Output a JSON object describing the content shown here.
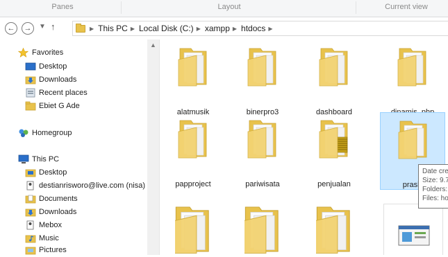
{
  "ribbon": {
    "groups": [
      "Panes",
      "Layout",
      "Current view"
    ]
  },
  "address": {
    "crumbs": [
      "This PC",
      "Local Disk (C:)",
      "xampp",
      "htdocs"
    ]
  },
  "nav": {
    "favorites": "Favorites",
    "favorites_items": [
      "Desktop",
      "Downloads",
      "Recent places",
      "Ebiet G Ade"
    ],
    "homegroup": "Homegroup",
    "thispc": "This PC",
    "thispc_items": [
      "Desktop",
      "destianrisworo@live.com (nisa)",
      "Documents",
      "Downloads",
      "Mebox",
      "Music",
      "Pictures"
    ]
  },
  "folders": [
    {
      "name": "alatmusik"
    },
    {
      "name": "binerpro3"
    },
    {
      "name": "dashboard"
    },
    {
      "name": "dinamis_php"
    },
    {
      "name": "papproject"
    },
    {
      "name": "pariwisata"
    },
    {
      "name": "penjualan"
    },
    {
      "name": "praskr"
    }
  ],
  "tooltip": {
    "lines": [
      "Date cre",
      "Size: 9.7",
      "Folders:",
      "Files: ho"
    ]
  },
  "colors": {
    "folder": "#e8c24c",
    "selection": "#cce8ff",
    "selection_border": "#99d1ff"
  }
}
